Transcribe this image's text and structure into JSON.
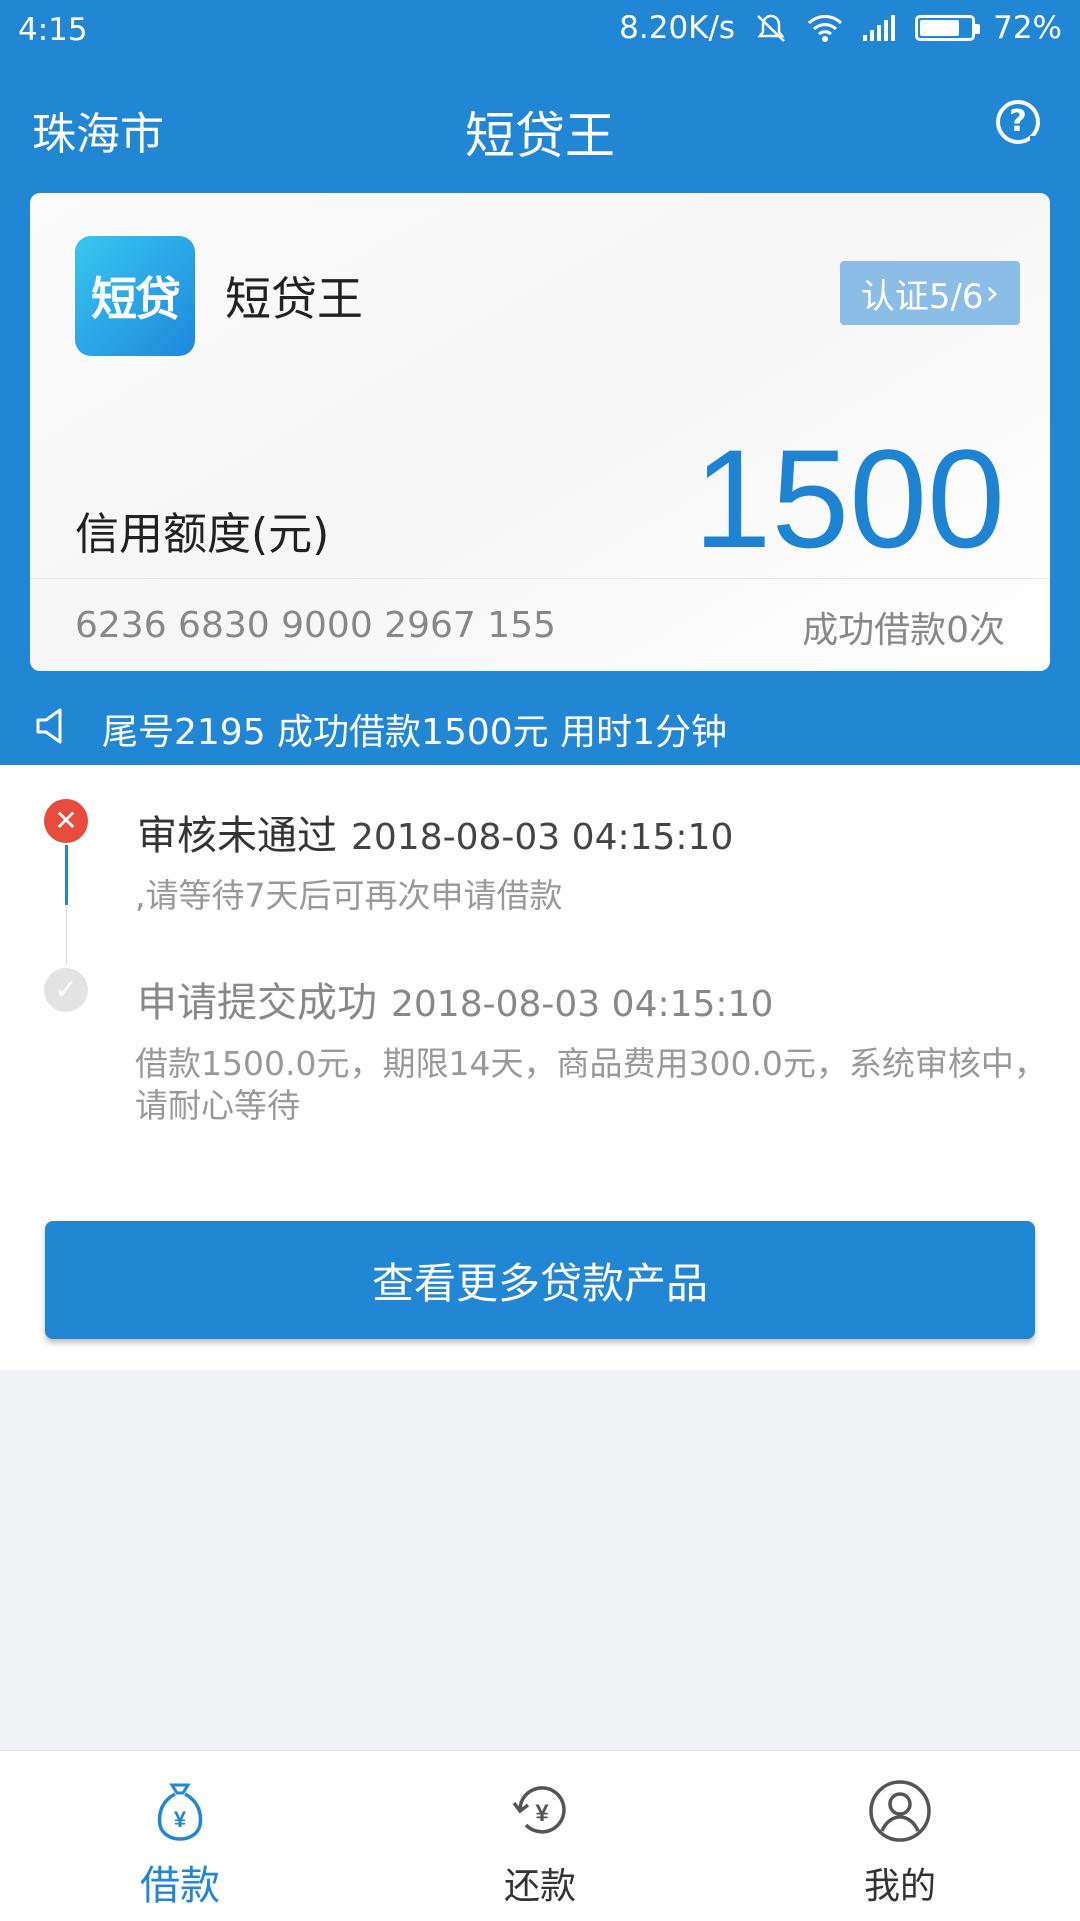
{
  "statusbar": {
    "time": "4:15",
    "speed": "8.20K/s",
    "battery": "72%"
  },
  "header": {
    "city": "珠海市",
    "title": "短贷王"
  },
  "card": {
    "logo_text": "短贷",
    "name": "短贷王",
    "verify_label": "认证5/6",
    "limit_label": "信用额度(元)",
    "limit_value": "1500",
    "card_number": "6236 6830 9000 2967 155",
    "success_text": "成功借款0次"
  },
  "notice": {
    "text": "尾号2195 成功借款1500元 用时1分钟"
  },
  "timeline": [
    {
      "title": "审核未通过",
      "time": "2018-08-03 04:15:10",
      "desc": ",请等待7天后可再次申请借款",
      "status": "failed"
    },
    {
      "title": "申请提交成功",
      "time": "2018-08-03 04:15:10",
      "desc": "借款1500.0元，期限14天，商品费用300.0元，系统审核中，请耐心等待",
      "status": "done"
    }
  ],
  "more_button": "查看更多贷款产品",
  "bottomnav": {
    "items": [
      {
        "label": "借款",
        "icon": "money-bag-icon",
        "active": true
      },
      {
        "label": "还款",
        "icon": "repay-icon",
        "active": false
      },
      {
        "label": "我的",
        "icon": "profile-icon",
        "active": false
      }
    ]
  },
  "colors": {
    "primary": "#2186d4",
    "error": "#e74b3c",
    "card_bg": "#ffffff",
    "page_bg": "#f1f2f6"
  }
}
